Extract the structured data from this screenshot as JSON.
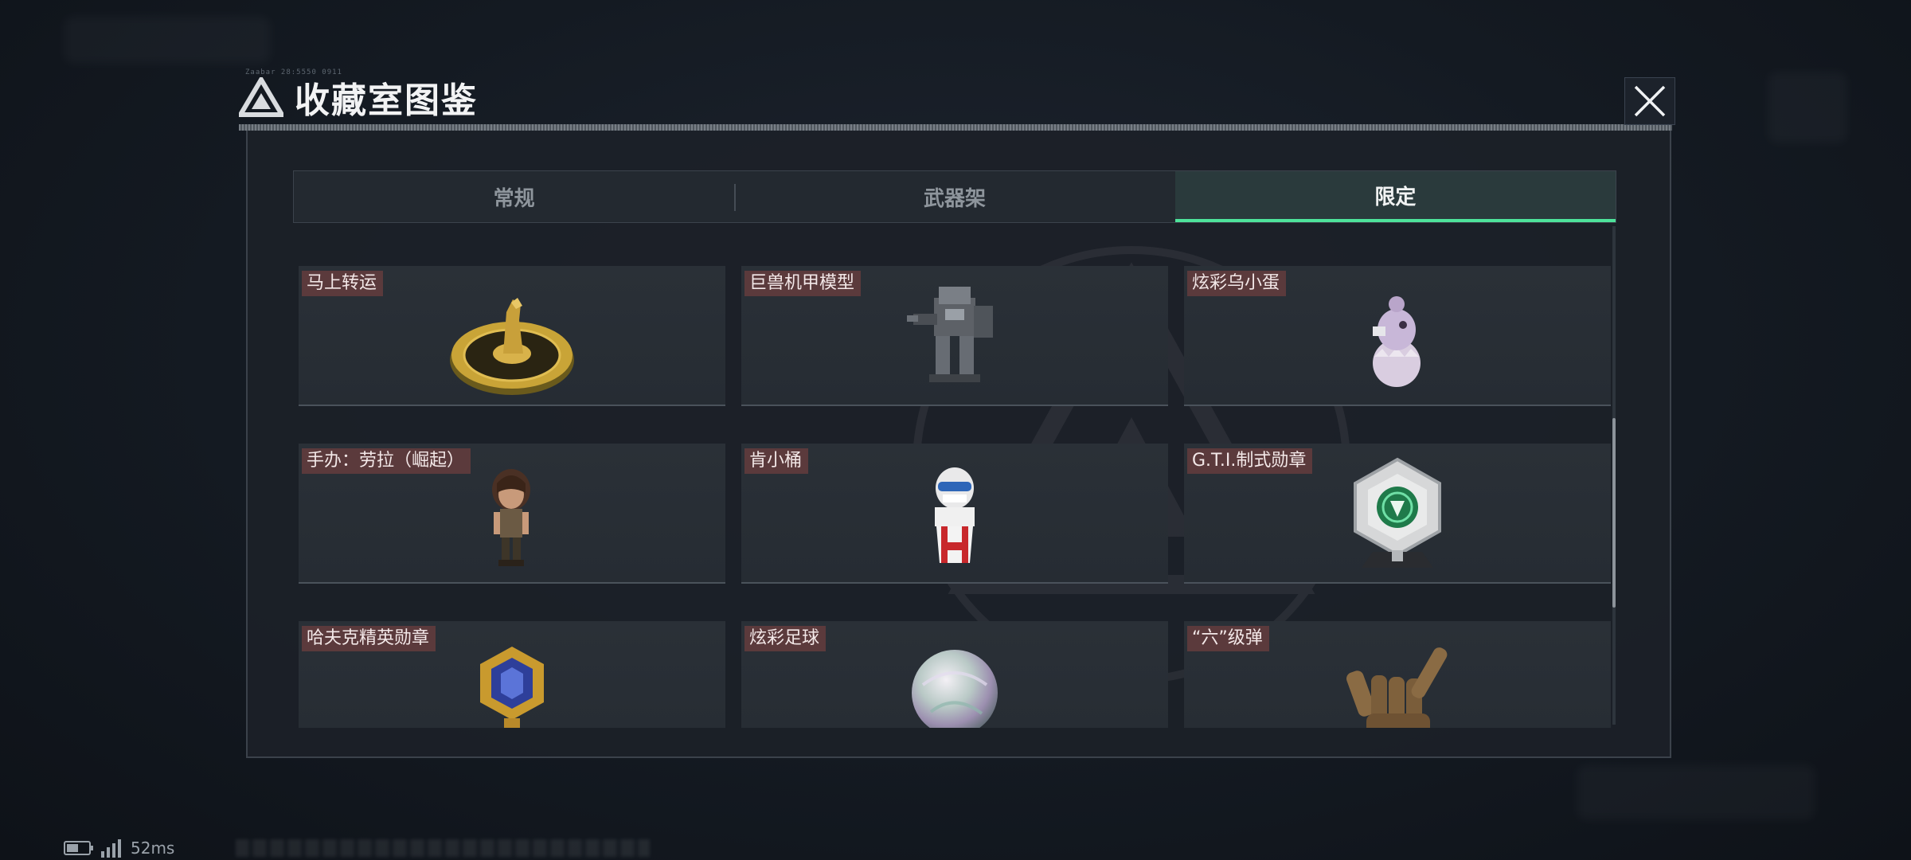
{
  "window": {
    "title": "收藏室图鉴",
    "title_tiny": "Zaabar 28:5550 0911",
    "close_icon": "close-icon"
  },
  "tabs": [
    {
      "label": "常规",
      "active": false
    },
    {
      "label": "武器架",
      "active": false
    },
    {
      "label": "限定",
      "active": true
    }
  ],
  "accent_color": "#4ee39b",
  "label_color": "#5b3a3c",
  "items": [
    {
      "name": "马上转运",
      "icon": "golden-horse-turntable-icon"
    },
    {
      "name": "巨兽机甲模型",
      "icon": "mech-model-icon"
    },
    {
      "name": "炫彩乌小蛋",
      "icon": "hatching-egg-figure-icon"
    },
    {
      "name": "手办：劳拉（崛起）",
      "icon": "lara-figure-icon"
    },
    {
      "name": "肯小桶",
      "icon": "kfc-bucket-figure-icon"
    },
    {
      "name": "G.T.I.制式勋章",
      "icon": "gti-medal-icon"
    },
    {
      "name": "哈夫克精英勋章",
      "icon": "haavk-elite-medal-icon"
    },
    {
      "name": "炫彩足球",
      "icon": "iridescent-football-icon"
    },
    {
      "name": "“六”级弹",
      "icon": "shaka-hand-bullet-icon"
    }
  ],
  "scroll": {
    "position_fraction": 0.62,
    "visible_fraction": 0.38
  },
  "status": {
    "ping": "52ms",
    "battery_icon": "battery-icon",
    "signal_icon": "signal-icon"
  }
}
